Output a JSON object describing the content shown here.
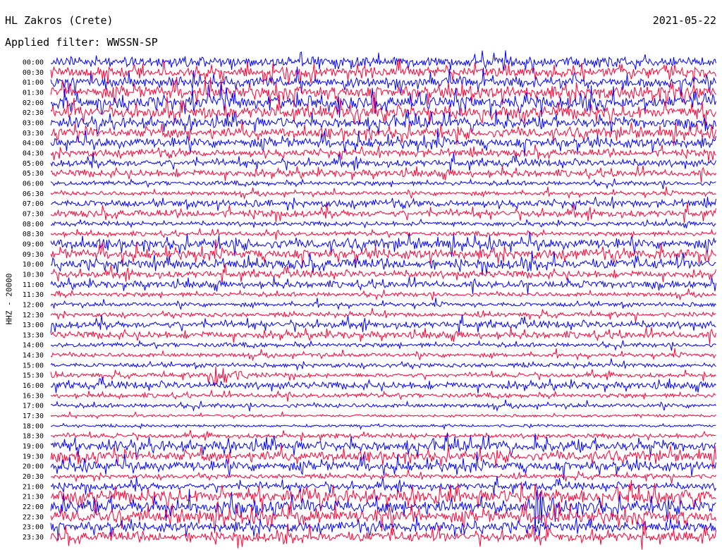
{
  "header": {
    "station": "HL Zakros (Crete)",
    "date": "2021-05-22",
    "filter": "Applied filter: WWSSN-SP"
  },
  "chart_data": {
    "type": "line",
    "kind": "helicorder",
    "title": "HL Zakros (Crete)",
    "date": "2021-05-22",
    "filter_label": "Applied filter: WWSSN-SP",
    "ylabel": "HHZ - 20000",
    "tick_labels": [
      "00:00",
      "00:30",
      "01:00",
      "01:30",
      "02:00",
      "02:30",
      "03:00",
      "03:30",
      "04:00",
      "04:30",
      "05:00",
      "05:30",
      "06:00",
      "06:30",
      "07:00",
      "07:30",
      "08:00",
      "08:30",
      "09:00",
      "09:30",
      "10:00",
      "10:30",
      "11:00",
      "11:30",
      "12:00",
      "12:30",
      "13:00",
      "13:30",
      "14:00",
      "14:30",
      "15:00",
      "15:30",
      "16:00",
      "16:30",
      "17:00",
      "17:30",
      "18:00",
      "18:30",
      "19:00",
      "19:30",
      "20:00",
      "20:30",
      "21:00",
      "21:30",
      "22:00",
      "22:30",
      "23:00",
      "23:30"
    ],
    "series_colors": [
      "#0000ff",
      "#ff0033"
    ],
    "row_activity": [
      3,
      3,
      3,
      4,
      4,
      4,
      3,
      3,
      3,
      2,
      2,
      2,
      1,
      1,
      2,
      2,
      1,
      1,
      3,
      3,
      3,
      2,
      2,
      1,
      1,
      1,
      2,
      2,
      1,
      1,
      1,
      1,
      2,
      1,
      1,
      0,
      0,
      1,
      3,
      3,
      3,
      1,
      2,
      4,
      4,
      4,
      3,
      3
    ],
    "events": [
      {
        "time": "15:30",
        "amplitude": "large"
      },
      {
        "time": "22:00",
        "amplitude": "large"
      }
    ]
  }
}
